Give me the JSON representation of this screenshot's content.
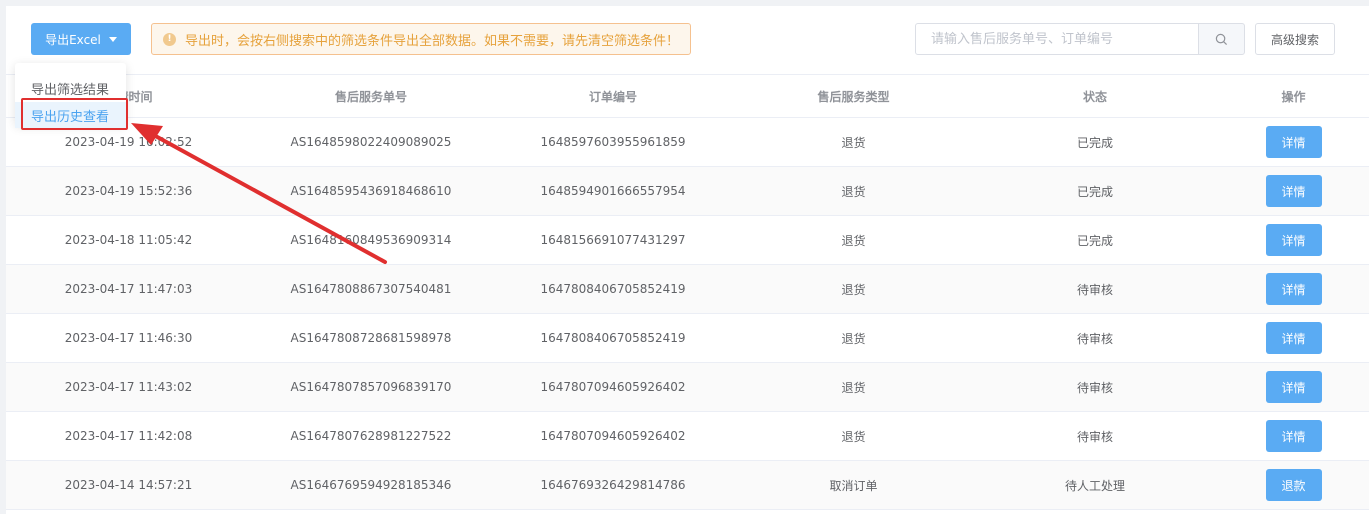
{
  "toolbar": {
    "export_label": "导出Excel",
    "notice_text": "导出时，会按右侧搜索中的筛选条件导出全部数据。如果不需要，请先清空筛选条件！",
    "search_placeholder": "请输入售后服务单号、订单编号",
    "advanced_search_label": "高级搜索"
  },
  "dropdown": {
    "items": [
      {
        "label": "导出筛选结果"
      },
      {
        "label": "导出历史查看"
      }
    ]
  },
  "table": {
    "headers": [
      "申请时间",
      "售后服务单号",
      "订单编号",
      "售后服务类型",
      "状态",
      "操作"
    ],
    "rows": [
      {
        "time": "2023-04-19 16:02:52",
        "service_no": "AS1648598022409089025",
        "order_no": "1648597603955961859",
        "type": "退货",
        "status": "已完成",
        "action": "详情"
      },
      {
        "time": "2023-04-19 15:52:36",
        "service_no": "AS1648595436918468610",
        "order_no": "1648594901666557954",
        "type": "退货",
        "status": "已完成",
        "action": "详情"
      },
      {
        "time": "2023-04-18 11:05:42",
        "service_no": "AS1648160849536909314",
        "order_no": "1648156691077431297",
        "type": "退货",
        "status": "已完成",
        "action": "详情"
      },
      {
        "time": "2023-04-17 11:47:03",
        "service_no": "AS1647808867307540481",
        "order_no": "1647808406705852419",
        "type": "退货",
        "status": "待审核",
        "action": "详情"
      },
      {
        "time": "2023-04-17 11:46:30",
        "service_no": "AS1647808728681598978",
        "order_no": "1647808406705852419",
        "type": "退货",
        "status": "待审核",
        "action": "详情"
      },
      {
        "time": "2023-04-17 11:43:02",
        "service_no": "AS1647807857096839170",
        "order_no": "1647807094605926402",
        "type": "退货",
        "status": "待审核",
        "action": "详情"
      },
      {
        "time": "2023-04-17 11:42:08",
        "service_no": "AS1647807628981227522",
        "order_no": "1647807094605926402",
        "type": "退货",
        "status": "待审核",
        "action": "详情"
      },
      {
        "time": "2023-04-14 14:57:21",
        "service_no": "AS1646769594928185346",
        "order_no": "1646769326429814786",
        "type": "取消订单",
        "status": "待人工处理",
        "action": "退款"
      }
    ]
  },
  "icons": {
    "warning": "warning-icon",
    "search": "search-icon",
    "caret": "caret-down-icon"
  },
  "colors": {
    "primary": "#5aabf3",
    "warning_bg": "#fdf6ec",
    "warning_text": "#e6a23c",
    "annotation_red": "#e02f2f"
  }
}
